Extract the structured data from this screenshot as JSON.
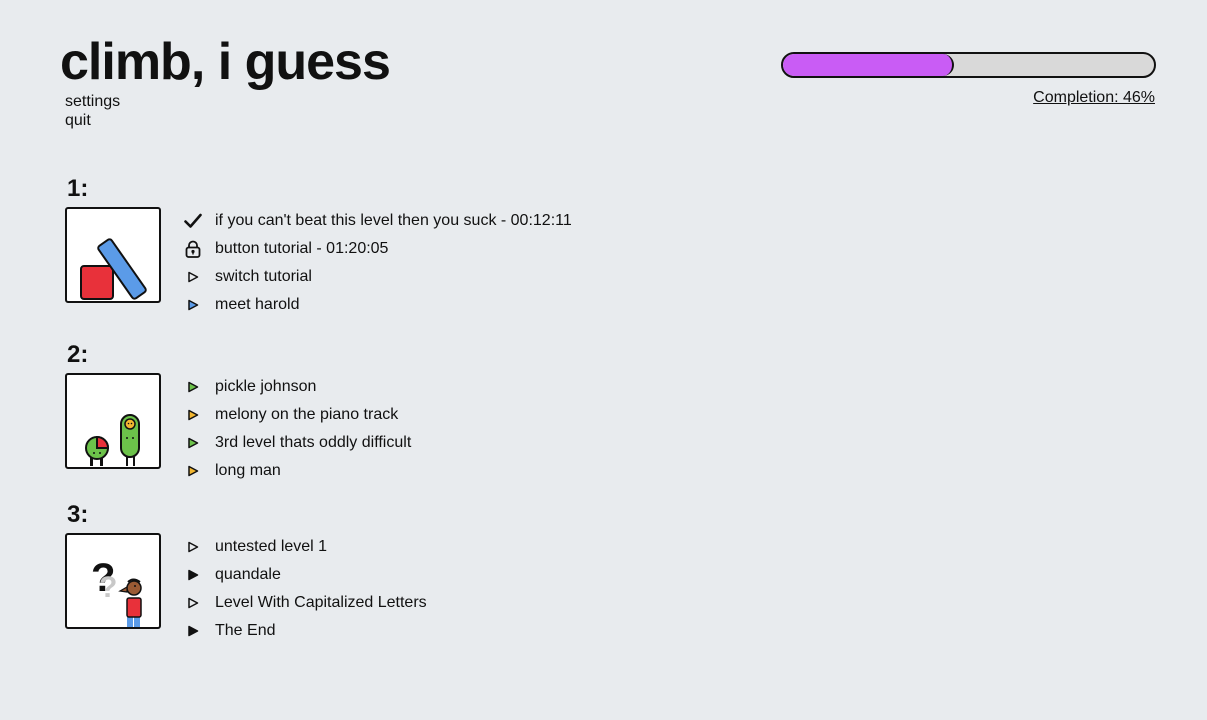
{
  "title": "climb, i guess",
  "menu": {
    "settings": "settings",
    "quit": "quit"
  },
  "progress": {
    "fraction": 0.46,
    "fill_color": "#c95cf5",
    "label": "Completion: 46%"
  },
  "chapters": [
    {
      "number": "1:",
      "levels": [
        {
          "label": "if you can't beat this level then you suck - 00:12:11",
          "icon": "checkmark-icon"
        },
        {
          "label": "button tutorial - 01:20:05",
          "icon": "lock-icon"
        },
        {
          "label": "switch tutorial",
          "icon": "play-outline-icon"
        },
        {
          "label": "meet harold",
          "icon": "play-blue-icon"
        }
      ]
    },
    {
      "number": "2:",
      "levels": [
        {
          "label": "pickle johnson",
          "icon": "play-green-icon"
        },
        {
          "label": "melony on the piano track",
          "icon": "play-yellow-icon"
        },
        {
          "label": "3rd level thats oddly difficult",
          "icon": "play-green-icon"
        },
        {
          "label": "long man",
          "icon": "play-yellow-icon"
        }
      ]
    },
    {
      "number": "3:",
      "levels": [
        {
          "label": "untested level 1",
          "icon": "play-outline-icon"
        },
        {
          "label": "quandale",
          "icon": "play-black-icon"
        },
        {
          "label": "Level With Capitalized Letters",
          "icon": "play-outline-icon"
        },
        {
          "label": "The End",
          "icon": "play-black-icon"
        }
      ]
    }
  ],
  "colors": {
    "blue": "#5b9be8",
    "green": "#6cc24a",
    "yellow": "#f2b630",
    "red": "#e8313a"
  }
}
